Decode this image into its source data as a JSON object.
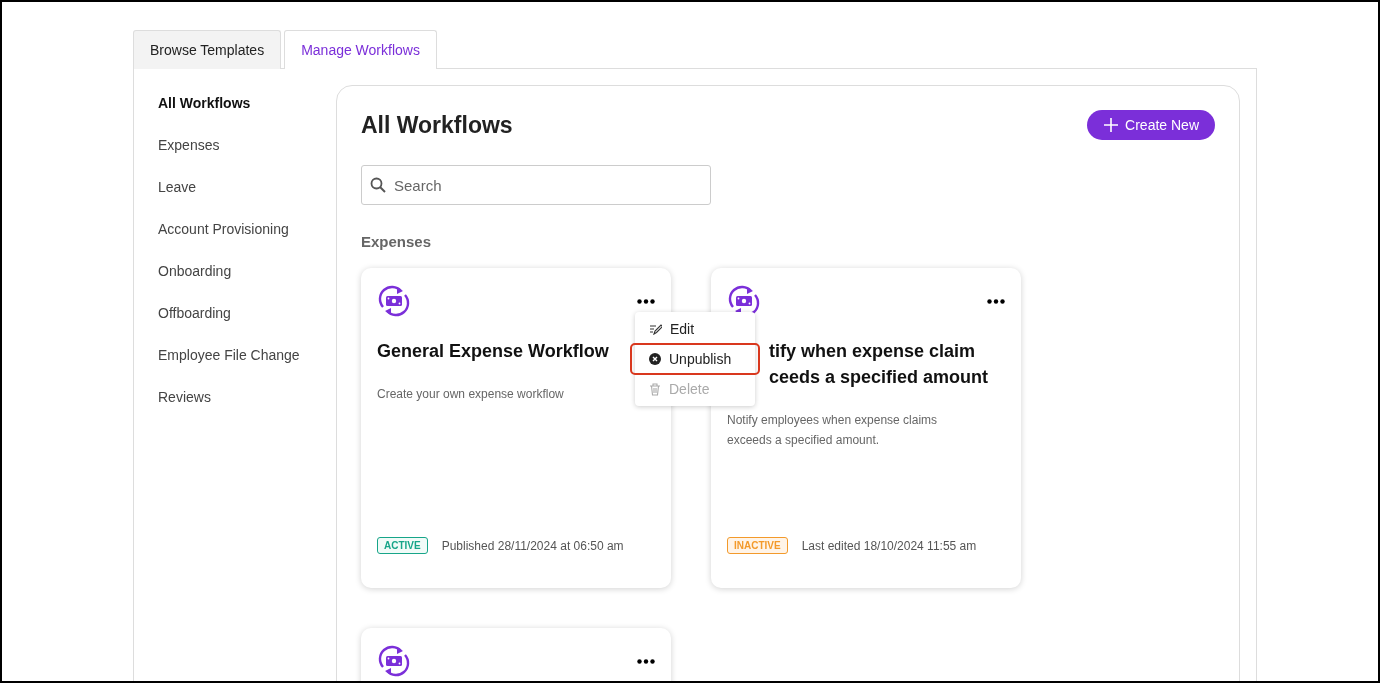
{
  "tabs": [
    {
      "label": "Browse Templates",
      "selected": false
    },
    {
      "label": "Manage Workflows",
      "selected": true
    }
  ],
  "sidebar": {
    "items": [
      {
        "label": "All Workflows",
        "selected": true
      },
      {
        "label": "Expenses",
        "selected": false
      },
      {
        "label": "Leave",
        "selected": false
      },
      {
        "label": "Account Provisioning",
        "selected": false
      },
      {
        "label": "Onboarding",
        "selected": false
      },
      {
        "label": "Offboarding",
        "selected": false
      },
      {
        "label": "Employee File Change",
        "selected": false
      },
      {
        "label": "Reviews",
        "selected": false
      }
    ]
  },
  "main": {
    "title": "All Workflows",
    "create_button": {
      "label": "Create New"
    },
    "search": {
      "placeholder": "Search"
    },
    "section": "Expenses",
    "cards": [
      {
        "title_lines": [
          "General Expense Workflow"
        ],
        "description": "Create your own expense workflow",
        "status": {
          "label": "ACTIVE",
          "kind": "active"
        },
        "meta": "Published 28/11/2024 at 06:50 am",
        "menu_open": true
      },
      {
        "title_lines": [
          "tify when expense claim",
          "ceeds a specified amount"
        ],
        "description": "Notify employees when expense claims exceeds a specified amount.",
        "status": {
          "label": "INACTIVE",
          "kind": "inactive"
        },
        "meta": "Last edited 18/10/2024 11:55 am",
        "menu_open": false
      },
      {
        "menu_open": false
      }
    ],
    "menu": {
      "items": [
        {
          "label": "Edit",
          "kind": "edit",
          "disabled": false,
          "highlighted": false
        },
        {
          "label": "Unpublish",
          "kind": "unpublish",
          "disabled": false,
          "highlighted": true
        },
        {
          "label": "Delete",
          "kind": "delete",
          "disabled": true,
          "highlighted": false
        }
      ]
    }
  }
}
